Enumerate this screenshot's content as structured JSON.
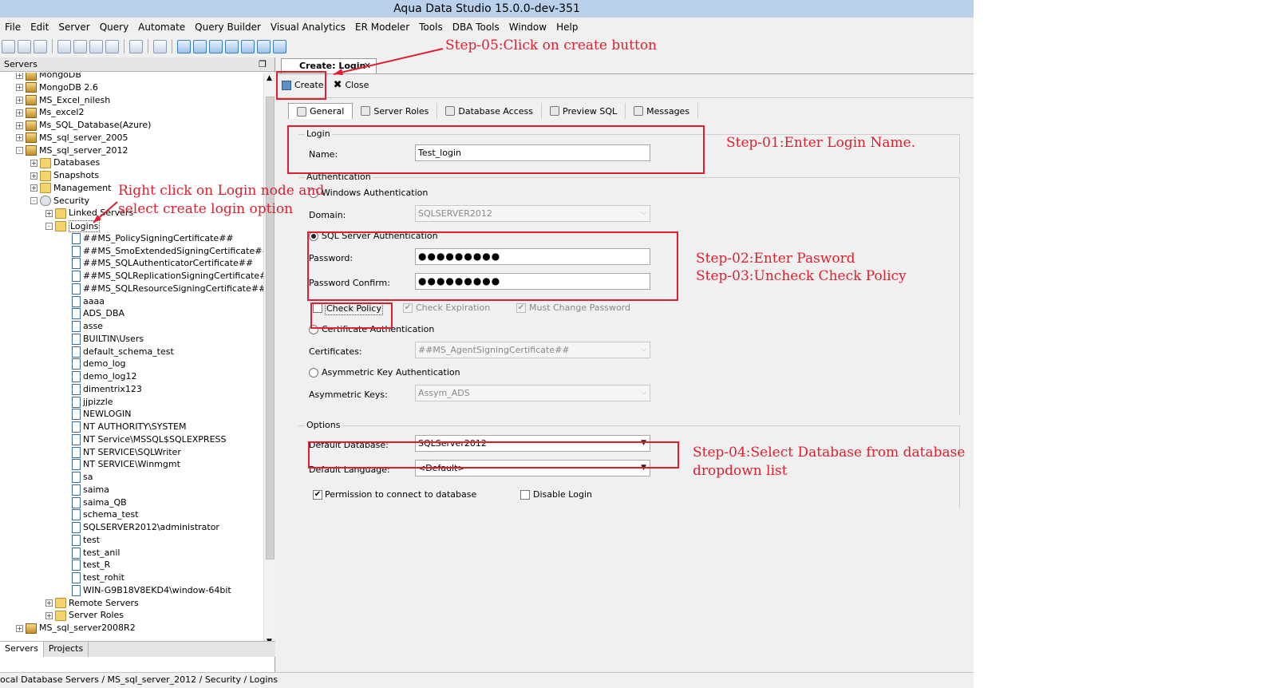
{
  "window": {
    "title": "Aqua Data Studio 15.0.0-dev-351"
  },
  "menu": [
    "File",
    "Edit",
    "Server",
    "Query",
    "Automate",
    "Query Builder",
    "Visual Analytics",
    "ER Modeler",
    "Tools",
    "DBA Tools",
    "Window",
    "Help"
  ],
  "servers_panel": {
    "title": "Servers",
    "tree": [
      {
        "label": "MongoDB",
        "level": 0,
        "icon": "server-icon",
        "exp": "+"
      },
      {
        "label": "MongoDB 2.6",
        "level": 0,
        "icon": "server-icon",
        "exp": "+"
      },
      {
        "label": "MS_Excel_nilesh",
        "level": 0,
        "icon": "server-icon",
        "exp": "+"
      },
      {
        "label": "Ms_excel2",
        "level": 0,
        "icon": "server-icon",
        "exp": "+"
      },
      {
        "label": "Ms_SQL_Database(Azure)",
        "level": 0,
        "icon": "server-icon",
        "exp": "+"
      },
      {
        "label": "MS_sql_server_2005",
        "level": 0,
        "icon": "server-icon",
        "exp": "+"
      },
      {
        "label": "MS_sql_server_2012",
        "level": 0,
        "icon": "server-icon",
        "exp": "-"
      },
      {
        "label": "Databases",
        "level": 1,
        "icon": "folder-icon",
        "exp": "+"
      },
      {
        "label": "Snapshots",
        "level": 1,
        "icon": "folder-icon",
        "exp": "+"
      },
      {
        "label": "Management",
        "level": 1,
        "icon": "folder-icon",
        "exp": "+"
      },
      {
        "label": "Security",
        "level": 1,
        "icon": "security-icon",
        "exp": "-"
      },
      {
        "label": "Linked Servers",
        "level": 2,
        "icon": "folder-icon",
        "exp": "+"
      },
      {
        "label": "Logins",
        "level": 2,
        "icon": "folder-icon",
        "exp": "-"
      },
      {
        "label": "##MS_PolicySigningCertificate##",
        "level": 3,
        "icon": "user-icon",
        "exp": ""
      },
      {
        "label": "##MS_SmoExtendedSigningCertificate##",
        "level": 3,
        "icon": "user-icon",
        "exp": ""
      },
      {
        "label": "##MS_SQLAuthenticatorCertificate##",
        "level": 3,
        "icon": "user-icon",
        "exp": ""
      },
      {
        "label": "##MS_SQLReplicationSigningCertificate##",
        "level": 3,
        "icon": "user-icon",
        "exp": ""
      },
      {
        "label": "##MS_SQLResourceSigningCertificate##",
        "level": 3,
        "icon": "user-icon",
        "exp": ""
      },
      {
        "label": "aaaa",
        "level": 3,
        "icon": "user-icon",
        "exp": ""
      },
      {
        "label": "ADS_DBA",
        "level": 3,
        "icon": "user-icon",
        "exp": ""
      },
      {
        "label": "asse",
        "level": 3,
        "icon": "user-icon",
        "exp": ""
      },
      {
        "label": "BUILTIN\\Users",
        "level": 3,
        "icon": "user-icon",
        "exp": ""
      },
      {
        "label": "default_schema_test",
        "level": 3,
        "icon": "user-icon",
        "exp": ""
      },
      {
        "label": "demo_log",
        "level": 3,
        "icon": "user-icon",
        "exp": ""
      },
      {
        "label": "demo_log12",
        "level": 3,
        "icon": "user-icon",
        "exp": ""
      },
      {
        "label": "dimentrix123",
        "level": 3,
        "icon": "user-icon",
        "exp": ""
      },
      {
        "label": "jjpizzle",
        "level": 3,
        "icon": "user-icon",
        "exp": ""
      },
      {
        "label": "NEWLOGIN",
        "level": 3,
        "icon": "user-icon",
        "exp": ""
      },
      {
        "label": "NT AUTHORITY\\SYSTEM",
        "level": 3,
        "icon": "user-icon",
        "exp": ""
      },
      {
        "label": "NT Service\\MSSQL$SQLEXPRESS",
        "level": 3,
        "icon": "user-icon",
        "exp": ""
      },
      {
        "label": "NT SERVICE\\SQLWriter",
        "level": 3,
        "icon": "user-icon",
        "exp": ""
      },
      {
        "label": "NT SERVICE\\Winmgmt",
        "level": 3,
        "icon": "user-icon",
        "exp": ""
      },
      {
        "label": "sa",
        "level": 3,
        "icon": "user-icon",
        "exp": ""
      },
      {
        "label": "saima",
        "level": 3,
        "icon": "user-icon",
        "exp": ""
      },
      {
        "label": "saima_QB",
        "level": 3,
        "icon": "user-icon",
        "exp": ""
      },
      {
        "label": "schema_test",
        "level": 3,
        "icon": "user-icon",
        "exp": ""
      },
      {
        "label": "SQLSERVER2012\\administrator",
        "level": 3,
        "icon": "user-icon",
        "exp": ""
      },
      {
        "label": "test",
        "level": 3,
        "icon": "user-icon",
        "exp": ""
      },
      {
        "label": "test_anil",
        "level": 3,
        "icon": "user-icon",
        "exp": ""
      },
      {
        "label": "test_R",
        "level": 3,
        "icon": "user-icon",
        "exp": ""
      },
      {
        "label": "test_rohit",
        "level": 3,
        "icon": "user-icon",
        "exp": ""
      },
      {
        "label": "WIN-G9B18V8EKD4\\window-64bit",
        "level": 3,
        "icon": "user-icon",
        "exp": ""
      },
      {
        "label": "Remote Servers",
        "level": 2,
        "icon": "folder-icon",
        "exp": "+"
      },
      {
        "label": "Server Roles",
        "level": 2,
        "icon": "folder-icon",
        "exp": "+"
      },
      {
        "label": "MS_sql_server2008R2",
        "level": 0,
        "icon": "server-icon",
        "exp": "+"
      }
    ],
    "tabs": [
      "Servers",
      "Projects"
    ]
  },
  "status": {
    "path": "ocal Database Servers / MS_sql_server_2012 / Security / Logins"
  },
  "editor": {
    "tab_label": "Create: Login",
    "actions": {
      "create": "Create",
      "close": "Close"
    },
    "subtabs": [
      "General",
      "Server Roles",
      "Database Access",
      "Preview SQL",
      "Messages"
    ],
    "login": {
      "group": "Login",
      "name_label": "Name:",
      "name_value": "Test_login"
    },
    "auth": {
      "group": "Authentication",
      "windows": "Windows Authentication",
      "domain_label": "Domain:",
      "domain_value": "SQLSERVER2012",
      "sql": "SQL Server Authentication",
      "password_label": "Password:",
      "password_value": "●●●●●●●●●",
      "confirm_label": "Password Confirm:",
      "confirm_value": "●●●●●●●●●",
      "check_policy": "Check Policy",
      "check_expiration": "Check Expiration",
      "must_change": "Must Change Password",
      "cert": "Certificate Authentication",
      "cert_label": "Certificates:",
      "cert_value": "##MS_AgentSigningCertificate##",
      "asym": "Asymmetric Key Authentication",
      "asym_label": "Asymmetric Keys:",
      "asym_value": "Assym_ADS"
    },
    "options": {
      "group": "Options",
      "db_label": "Default Database:",
      "db_value": "SQLServer2012",
      "lang_label": "Default Language:",
      "lang_value": "<Default>",
      "permission": "Permission to connect to database",
      "disable": "Disable Login"
    }
  },
  "annotations": {
    "step5": "Step-05:Click on create button",
    "step1": "Step-01:Enter Login Name.",
    "step2": "Step-02:Enter Pasword",
    "step3": "Step-03:Uncheck Check Policy",
    "step4_line1": "Step-04:Select Database from database",
    "step4_line2": "dropdown list",
    "right_click_line1": "Right click on Login node and",
    "right_click_line2": "select create login option",
    "color": "#e21d2c"
  }
}
